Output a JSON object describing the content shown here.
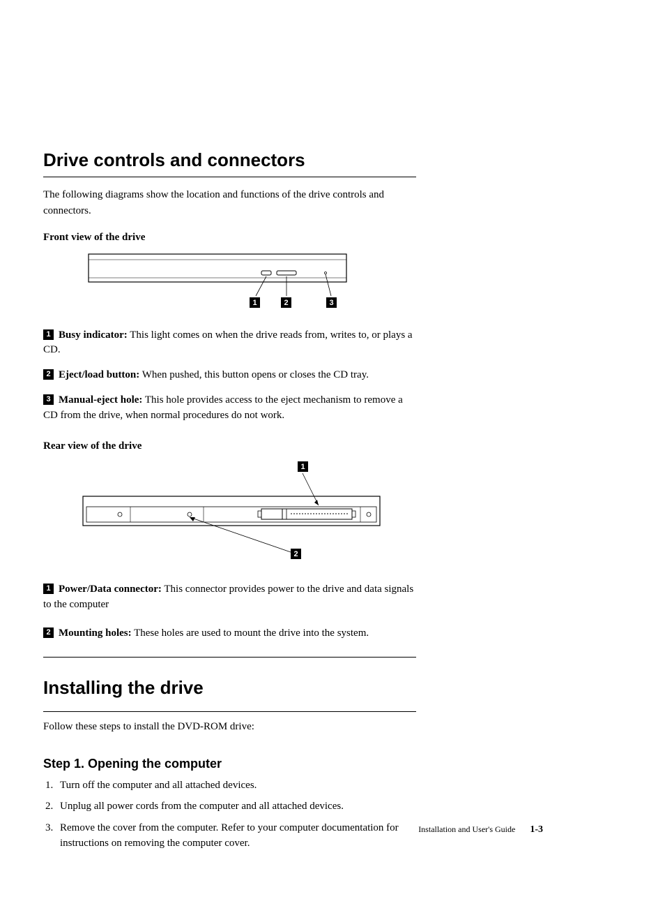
{
  "headings": {
    "drive_controls": "Drive controls and connectors",
    "front_view": "Front view of the drive",
    "rear_view": "Rear view of the drive",
    "installing": "Installing the drive",
    "step1": "Step 1. Opening the computer"
  },
  "intro": "The following diagrams show the location and functions of the drive controls and connectors.",
  "front_items": [
    {
      "num": "1",
      "label": "Busy indicator:",
      "text": " This light comes on when the drive reads from, writes to, or plays a CD."
    },
    {
      "num": "2",
      "label": "Eject/load button:",
      "text": " When pushed, this button opens or closes the CD tray."
    },
    {
      "num": "3",
      "label": "Manual-eject hole:",
      "text": " This hole provides access to the eject mechanism to remove a CD from the drive, when normal procedures do not work."
    }
  ],
  "rear_items": [
    {
      "num": "1",
      "label": "Power/Data connector:",
      "text": " This connector provides power to the drive and data signals to the computer"
    },
    {
      "num": "2",
      "label": "Mounting holes:",
      "text": " These holes are used to mount the drive into the system."
    }
  ],
  "install_intro": "Follow these steps to install the DVD-ROM drive:",
  "step1_list": [
    "Turn off the computer and all attached devices.",
    "Unplug all power cords from the computer and all attached devices.",
    "Remove the cover from the computer. Refer to your computer documentation for instructions on removing the computer cover."
  ],
  "footer": {
    "text": "Installation and User's Guide",
    "page": "1-3"
  }
}
